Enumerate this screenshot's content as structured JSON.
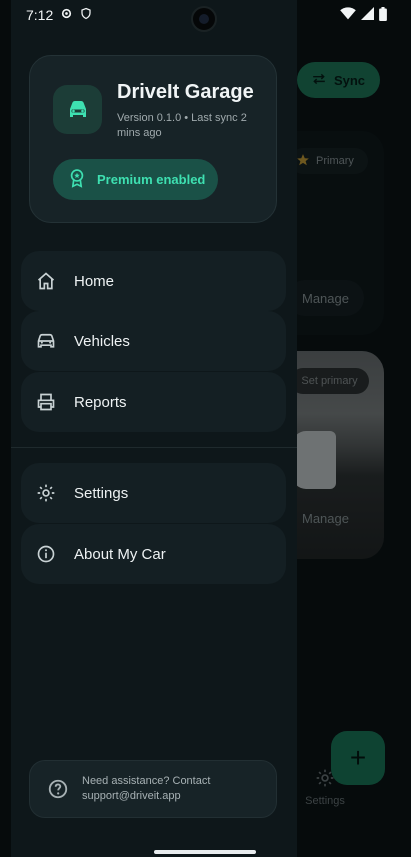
{
  "status_bar": {
    "time": "7:12",
    "icons": [
      "settings-gear-icon",
      "shield-icon",
      "wifi-icon",
      "signal-icon",
      "battery-icon"
    ]
  },
  "background_app": {
    "sync_label": "Sync",
    "primary_chip": "Primary",
    "manage_label_1": "Manage",
    "set_primary_chip": "Set primary",
    "manage_label_2": "Manage",
    "bottom_nav_settings": "Settings",
    "fab_icon": "+"
  },
  "drawer": {
    "app_title": "DriveIt Garage",
    "version_text": "Version 0.1.0 • Last sync 2 mins ago",
    "premium_label": "Premium enabled",
    "nav_items": [
      {
        "label": "Home",
        "icon": "home-icon"
      },
      {
        "label": "Vehicles",
        "icon": "car-icon"
      },
      {
        "label": "Reports",
        "icon": "printer-icon"
      },
      {
        "label": "Settings",
        "icon": "gear-icon"
      },
      {
        "label": "About My Car",
        "icon": "info-icon"
      }
    ],
    "help_text": "Need assistance? Contact support@driveit.app"
  },
  "colors": {
    "accent": "#3ee0b1",
    "drawer_bg": "#0e171a",
    "card_bg": "#172327"
  }
}
